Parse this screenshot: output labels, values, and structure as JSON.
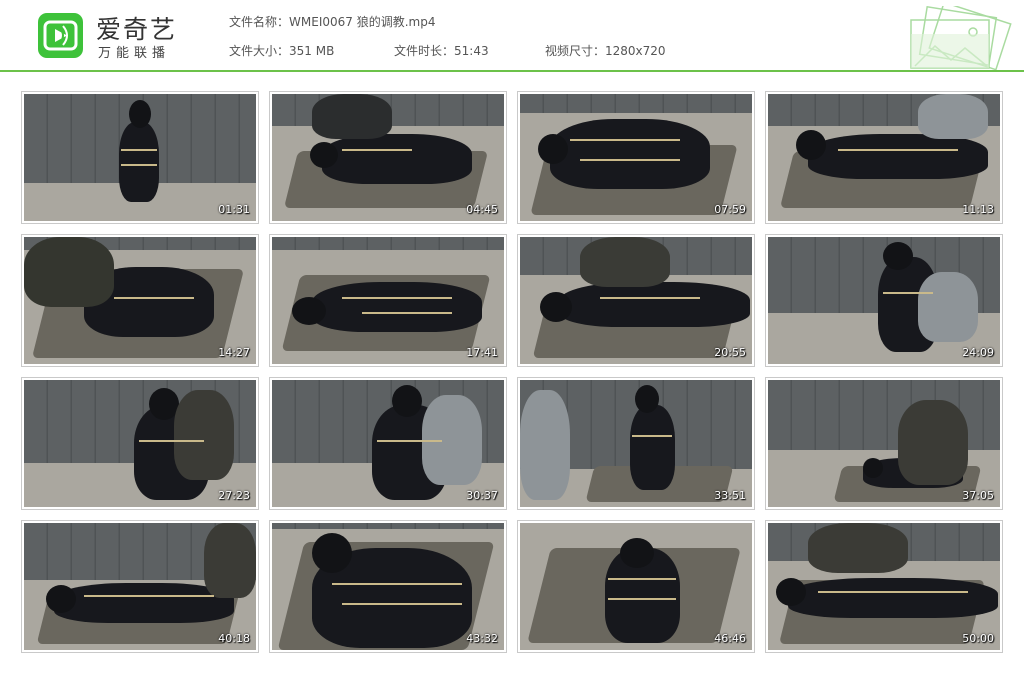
{
  "brand": {
    "title": "爱奇艺",
    "subtitle": "万能联播",
    "accent": "#3ec23a"
  },
  "file_info": {
    "name_label": "文件名称：",
    "name_value": "WMEI0067 狼的调教.mp4",
    "size_label": "文件大小：",
    "size_value": "351 MB",
    "duration_label": "文件时长：",
    "duration_value": "51:43",
    "dimensions_label": "视频尺寸：",
    "dimensions_value": "1280x720"
  },
  "thumbnails": [
    {
      "time": "01:31"
    },
    {
      "time": "04:45"
    },
    {
      "time": "07:59"
    },
    {
      "time": "11:13"
    },
    {
      "time": "14:27"
    },
    {
      "time": "17:41"
    },
    {
      "time": "20:55"
    },
    {
      "time": "24:09"
    },
    {
      "time": "27:23"
    },
    {
      "time": "30:37"
    },
    {
      "time": "33:51"
    },
    {
      "time": "37:05"
    },
    {
      "time": "40:18"
    },
    {
      "time": "43:32"
    },
    {
      "time": "46:46"
    },
    {
      "time": "50:00"
    }
  ]
}
